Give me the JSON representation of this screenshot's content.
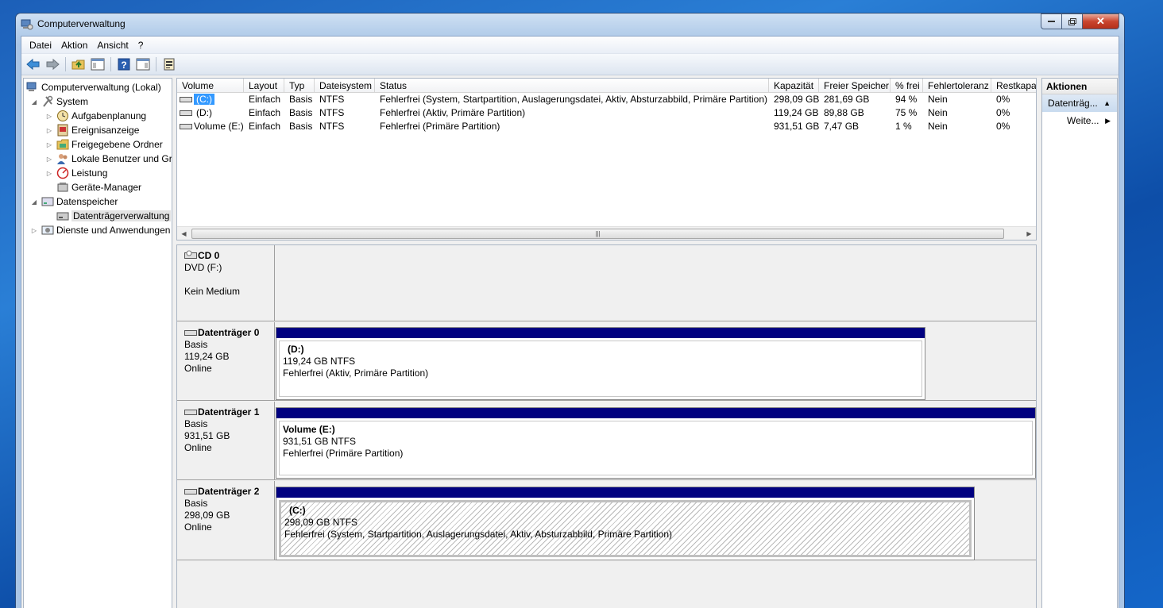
{
  "window": {
    "title": "Computerverwaltung"
  },
  "menu": [
    "Datei",
    "Aktion",
    "Ansicht",
    "?"
  ],
  "tree": {
    "root": "Computerverwaltung (Lokal)",
    "system": "System",
    "system_items": [
      "Aufgabenplanung",
      "Ereignisanzeige",
      "Freigegebene Ordner",
      "Lokale Benutzer und Gruppen",
      "Leistung",
      "Geräte-Manager"
    ],
    "storage": "Datenspeicher",
    "storage_items": [
      "Datenträgerverwaltung"
    ],
    "services": "Dienste und Anwendungen"
  },
  "list": {
    "headers": [
      "Volume",
      "Layout",
      "Typ",
      "Dateisystem",
      "Status",
      "Kapazität",
      "Freier Speicher",
      "% frei",
      "Fehlertoleranz",
      "Restkapaz"
    ],
    "rows": [
      {
        "volume": "(C:)",
        "layout": "Einfach",
        "typ": "Basis",
        "fs": "NTFS",
        "status": "Fehlerfrei (System, Startpartition, Auslagerungsdatei, Aktiv, Absturzabbild, Primäre Partition)",
        "cap": "298,09 GB",
        "free": "281,69 GB",
        "pct": "94 %",
        "ft": "Nein",
        "rest": "0%"
      },
      {
        "volume": "(D:)",
        "layout": "Einfach",
        "typ": "Basis",
        "fs": "NTFS",
        "status": "Fehlerfrei (Aktiv, Primäre Partition)",
        "cap": "119,24 GB",
        "free": "89,88 GB",
        "pct": "75 %",
        "ft": "Nein",
        "rest": "0%"
      },
      {
        "volume": "Volume (E:)",
        "layout": "Einfach",
        "typ": "Basis",
        "fs": "NTFS",
        "status": "Fehlerfrei (Primäre Partition)",
        "cap": "931,51 GB",
        "free": "7,47 GB",
        "pct": "1 %",
        "ft": "Nein",
        "rest": "0%"
      }
    ]
  },
  "disks": [
    {
      "name": "CD 0",
      "line1": "DVD (F:)",
      "line2": "",
      "line3": "Kein Medium"
    },
    {
      "name": "Datenträger 0",
      "line1": "Basis",
      "line2": "119,24 GB",
      "line3": "Online",
      "part": {
        "name": "(D:)",
        "size": "119,24 GB NTFS",
        "status": "Fehlerfrei (Aktiv, Primäre Partition)"
      }
    },
    {
      "name": "Datenträger 1",
      "line1": "Basis",
      "line2": "931,51 GB",
      "line3": "Online",
      "part": {
        "name": "Volume  (E:)",
        "size": "931,51 GB NTFS",
        "status": "Fehlerfrei (Primäre Partition)"
      }
    },
    {
      "name": "Datenträger 2",
      "line1": "Basis",
      "line2": "298,09 GB",
      "line3": "Online",
      "part": {
        "name": "(C:)",
        "size": "298,09 GB NTFS",
        "status": "Fehlerfrei (System, Startpartition, Auslagerungsdatei, Aktiv, Absturzabbild, Primäre Partition)"
      }
    }
  ],
  "actions": {
    "header": "Aktionen",
    "section": "Datenträg...",
    "more": "Weite..."
  },
  "colors": {
    "partition_bar": "#000080",
    "selection": "#3399ff"
  }
}
